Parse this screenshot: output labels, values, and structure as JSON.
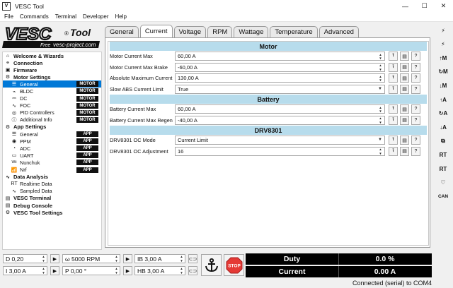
{
  "window": {
    "title": "VESC Tool",
    "minimize": "—",
    "maximize": "☐",
    "close": "✕"
  },
  "menu": [
    "File",
    "Commands",
    "Terminal",
    "Developer",
    "Help"
  ],
  "logo": {
    "brand": "VESC",
    "reg": "®",
    "tool": "Tool",
    "free": "Free",
    "url": "vesc-project.com"
  },
  "tree": [
    {
      "label": "Welcome & Wizards",
      "level": "top",
      "icon": "home-icon",
      "glyph": "⌂"
    },
    {
      "label": "Connection",
      "level": "top",
      "icon": "connection-icon",
      "glyph": "⚭"
    },
    {
      "label": "Firmware",
      "level": "top",
      "icon": "firmware-icon",
      "glyph": "▣"
    },
    {
      "label": "Motor Settings",
      "level": "top",
      "icon": "motor-icon",
      "glyph": "⚙"
    },
    {
      "label": "General",
      "level": "sub",
      "icon": "sliders-icon",
      "glyph": "☰",
      "badge": "MOTOR",
      "selected": true
    },
    {
      "label": "BLDC",
      "level": "sub",
      "icon": "bldc-icon",
      "glyph": "⌁",
      "badge": "MOTOR"
    },
    {
      "label": "DC",
      "level": "sub",
      "icon": "dc-icon",
      "glyph": "⎓",
      "badge": "MOTOR"
    },
    {
      "label": "FOC",
      "level": "sub",
      "icon": "foc-icon",
      "glyph": "∿",
      "badge": "MOTOR"
    },
    {
      "label": "PID Controllers",
      "level": "sub",
      "icon": "pid-icon",
      "glyph": "◎",
      "badge": "MOTOR"
    },
    {
      "label": "Additional Info",
      "level": "sub",
      "icon": "info-icon",
      "glyph": "ⓘ",
      "badge": "MOTOR"
    },
    {
      "label": "App Settings",
      "level": "top",
      "icon": "app-settings-icon",
      "glyph": "⚙"
    },
    {
      "label": "General",
      "level": "sub",
      "icon": "sliders-icon",
      "glyph": "☰",
      "badge": "APP"
    },
    {
      "label": "PPM",
      "level": "sub",
      "icon": "ppm-icon",
      "glyph": "◉",
      "badge": "APP"
    },
    {
      "label": "ADC",
      "level": "sub",
      "icon": "adc-icon",
      "glyph": "◔",
      "badge": "APP"
    },
    {
      "label": "UART",
      "level": "sub",
      "icon": "uart-icon",
      "glyph": "▭",
      "badge": "APP"
    },
    {
      "label": "Nunchuk",
      "level": "sub",
      "icon": "nunchuk-icon",
      "glyph": "Wii",
      "badge": "APP"
    },
    {
      "label": "Nrf",
      "level": "sub",
      "icon": "nrf-icon",
      "glyph": "📶",
      "badge": "APP"
    },
    {
      "label": "Data Analysis",
      "level": "top",
      "icon": "chart-icon",
      "glyph": "∿"
    },
    {
      "label": "Realtime Data",
      "level": "sub",
      "icon": "realtime-icon",
      "glyph": "RT"
    },
    {
      "label": "Sampled Data",
      "level": "sub",
      "icon": "sampled-icon",
      "glyph": "∿"
    },
    {
      "label": "VESC Terminal",
      "level": "top",
      "icon": "terminal-icon",
      "glyph": "▤"
    },
    {
      "label": "Debug Console",
      "level": "top",
      "icon": "debug-icon",
      "glyph": "▤"
    },
    {
      "label": "VESC Tool Settings",
      "level": "top",
      "icon": "settings-icon",
      "glyph": "⚙"
    }
  ],
  "tabs": [
    {
      "label": "General"
    },
    {
      "label": "Current",
      "active": true
    },
    {
      "label": "Voltage"
    },
    {
      "label": "RPM"
    },
    {
      "label": "Wattage"
    },
    {
      "label": "Temperature"
    },
    {
      "label": "Advanced"
    }
  ],
  "sections": [
    {
      "title": "Motor",
      "rows": [
        {
          "label": "Motor Current Max",
          "value": "60,00 A",
          "kind": "spin"
        },
        {
          "label": "Motor Current Max Brake",
          "value": "-60,00 A",
          "kind": "spin"
        },
        {
          "label": "Absolute Maximum Current",
          "value": "130,00 A",
          "kind": "spin"
        },
        {
          "label": "Slow ABS Current Limit",
          "value": "True",
          "kind": "combo"
        }
      ]
    },
    {
      "title": "Battery",
      "rows": [
        {
          "label": "Battery Current Max",
          "value": "60,00 A",
          "kind": "spin"
        },
        {
          "label": "Battery Current Max Regen",
          "value": "-40,00 A",
          "kind": "spin"
        }
      ]
    },
    {
      "title": "DRV8301",
      "rows": [
        {
          "label": "DRV8301 OC Mode",
          "value": "Current Limit",
          "kind": "combo"
        },
        {
          "label": "DRV8301 OC Adjustment",
          "value": "16",
          "kind": "spin"
        }
      ]
    }
  ],
  "param_buttons": {
    "upload": "⭱",
    "read_default": "▤",
    "help": "?"
  },
  "right_toolbar": [
    {
      "name": "connect-icon",
      "glyph": "⚡"
    },
    {
      "name": "disconnect-icon",
      "glyph": "⚡"
    },
    {
      "name": "read-motor-config-icon",
      "glyph": "↑M"
    },
    {
      "name": "read-default-motor-config-icon",
      "glyph": "↻M"
    },
    {
      "name": "write-motor-config-icon",
      "glyph": "↓M"
    },
    {
      "name": "read-app-config-icon",
      "glyph": "↑A"
    },
    {
      "name": "read-default-app-config-icon",
      "glyph": "↻A"
    },
    {
      "name": "write-app-config-icon",
      "glyph": "↓A"
    },
    {
      "name": "tree-icon",
      "glyph": "⧉"
    },
    {
      "name": "rt-data-icon",
      "glyph": "RT"
    },
    {
      "name": "rt-app-icon",
      "glyph": "RT"
    },
    {
      "name": "heart-icon",
      "glyph": "♡"
    },
    {
      "name": "can-icon",
      "glyph": "CAN"
    }
  ],
  "bottom": {
    "duty": "D 0,20",
    "speed": "ω 5000 RPM",
    "ib": "IB 3,00 A",
    "current": "I 3,00 A",
    "position": "P 0,00 °",
    "hb": "HB 3,00 A",
    "stop_label": "STOP"
  },
  "gauges": [
    {
      "label": "Duty",
      "value": "0.0 %",
      "fraction": 0.0
    },
    {
      "label": "Current",
      "value": "0.00 A",
      "fraction": 0.0
    }
  ],
  "status": "Connected (serial) to COM4",
  "colors": {
    "selection": "#0078d7",
    "section": "#b7dcec",
    "badge": "#111111",
    "stop": "#e53935",
    "gauge_bar": "#3a8f3a"
  }
}
